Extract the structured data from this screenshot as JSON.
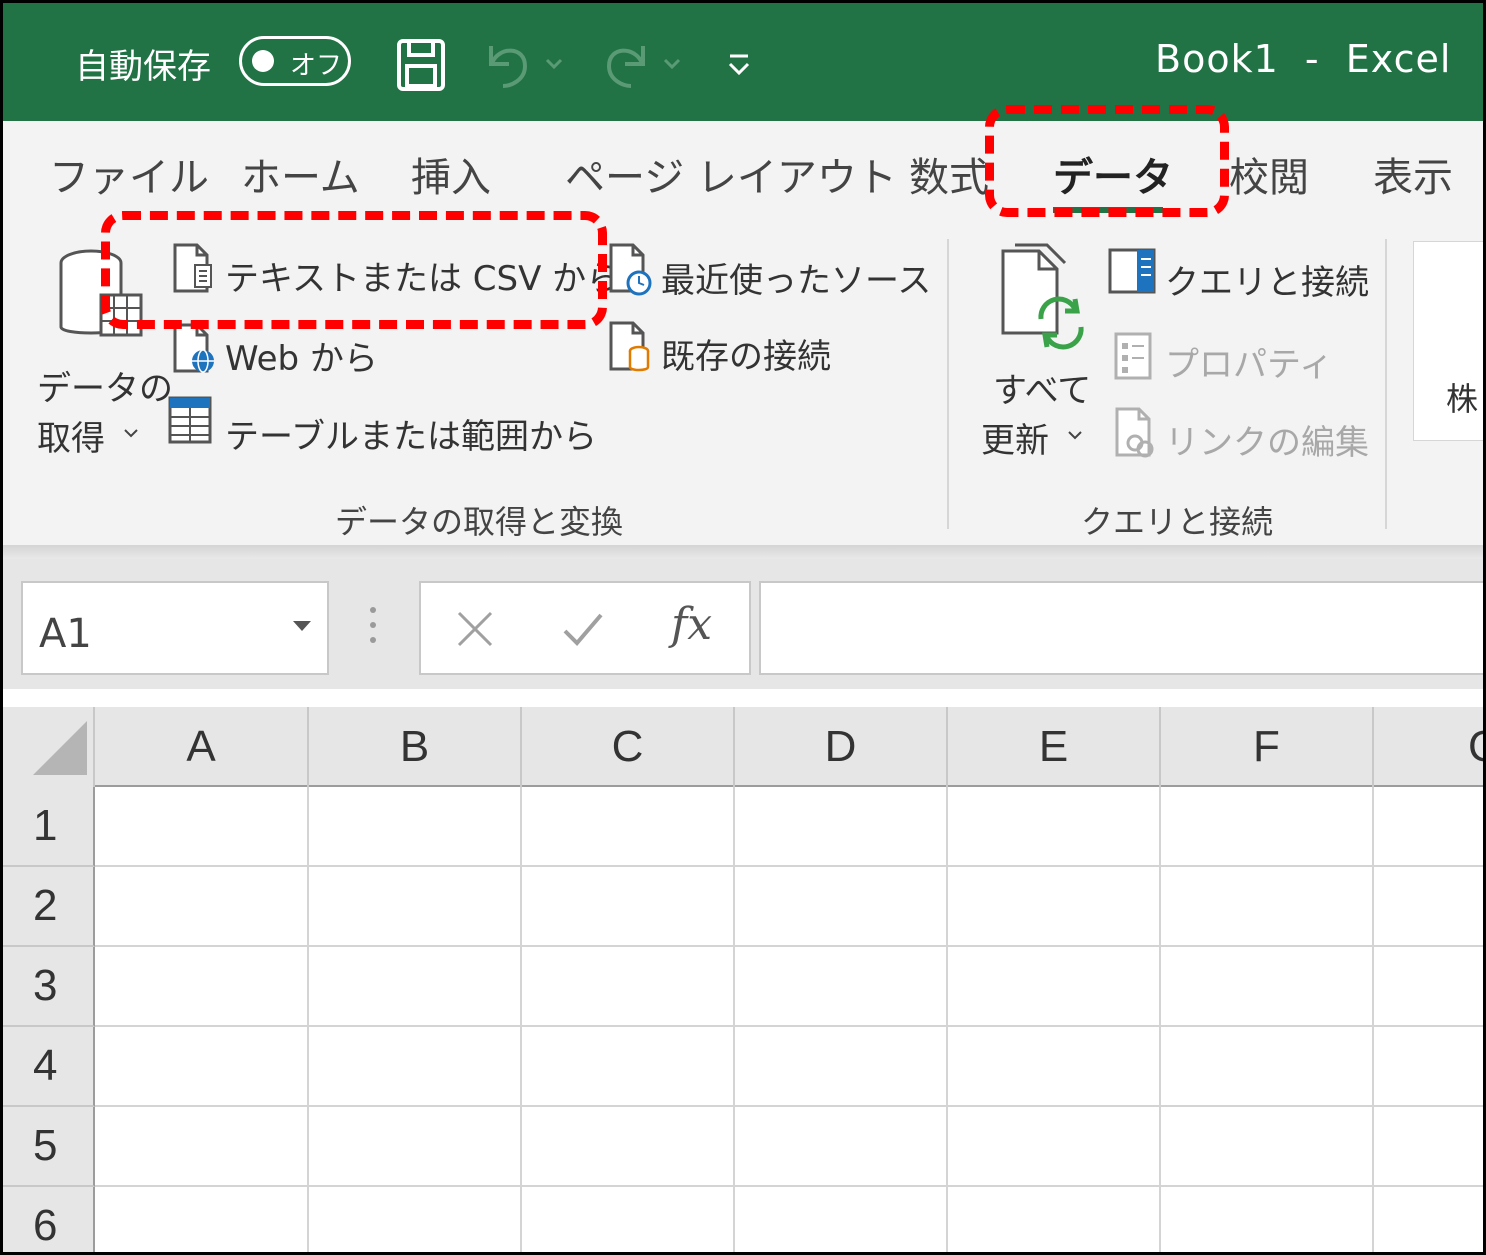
{
  "titlebar": {
    "autosave_label": "自動保存",
    "autosave_state": "オフ",
    "title": "Book1  -  Excel",
    "icons": [
      "save-icon",
      "undo-icon",
      "redo-icon",
      "customize-qat-icon"
    ],
    "color": "#217346"
  },
  "tabs": [
    {
      "label": "ファイル"
    },
    {
      "label": "ホーム"
    },
    {
      "label": "挿入"
    },
    {
      "label": "ページ レイアウト"
    },
    {
      "label": "数式"
    },
    {
      "label": "データ",
      "active": true
    },
    {
      "label": "校閲"
    },
    {
      "label": "表示"
    }
  ],
  "ribbon": {
    "get_data_line1": "データの",
    "get_data_line2": "取得",
    "from_text_csv": "テキストまたは CSV から",
    "from_web": "Web から",
    "from_table_range": "テーブルまたは範囲から",
    "recent_sources": "最近使ったソース",
    "existing_connections": "既存の接続",
    "group1_label": "データの取得と変換",
    "refresh_all_line1": "すべて",
    "refresh_all_line2": "更新",
    "queries_connections": "クエリと接続",
    "properties": "プロパティ",
    "edit_links": "リンクの編集",
    "group2_label": "クエリと接続",
    "stocks_partial": "株"
  },
  "formula_bar": {
    "name_box_value": "A1",
    "fx_label": "fx",
    "formula_value": ""
  },
  "grid": {
    "columns": [
      "A",
      "B",
      "C",
      "D",
      "E",
      "F",
      "G"
    ],
    "rows": [
      "1",
      "2",
      "3",
      "4",
      "5",
      "6"
    ]
  },
  "annotation_color": "#ff0000"
}
